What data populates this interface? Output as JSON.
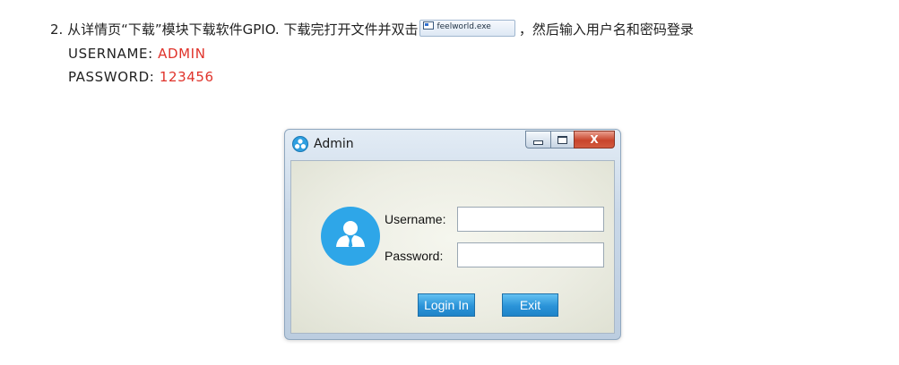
{
  "instruction": {
    "step_text": "2. 从详情页“下载”模块下载软件GPIO. 下载完打开文件并双击",
    "exe_name": "feelworld.exe",
    "after_text": "，然后输入用户名和密码登录",
    "username_label": "USERNAME: ",
    "username_value": "ADMIN",
    "password_label": "PASSWORD: ",
    "password_value": "123456"
  },
  "dialog": {
    "title": "Admin",
    "caption_buttons": {
      "minimize_icon": "minimize-icon",
      "maximize_icon": "maximize-icon",
      "close_glyph": "X"
    },
    "avatar_icon": "user-icon",
    "username_label": "Username:",
    "username_value": "",
    "password_label": "Password:",
    "password_value": "",
    "login_button": "Login In",
    "exit_button": "Exit"
  },
  "colors": {
    "accent_red": "#e0332b",
    "avatar_blue": "#2ea6e8",
    "button_blue": "#2a93d8",
    "close_red": "#c8452c"
  }
}
